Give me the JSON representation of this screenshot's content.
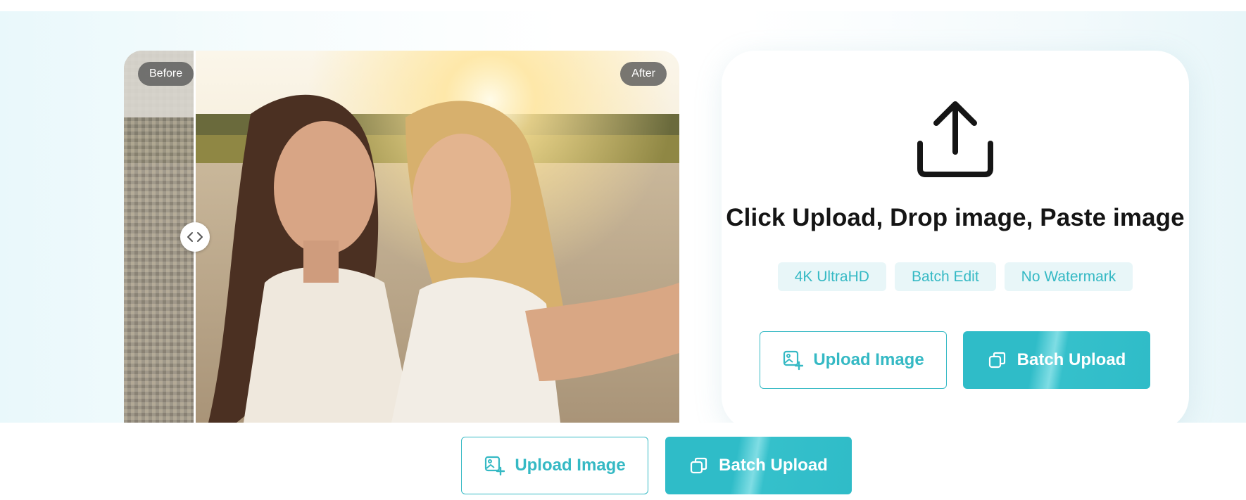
{
  "compare": {
    "before_label": "Before",
    "after_label": "After",
    "handle_icon": "chevrons-left-right-icon"
  },
  "upload_card": {
    "icon": "upload-arrow-icon",
    "title": "Click Upload, Drop image, Paste image",
    "features": [
      "4K UltraHD",
      "Batch Edit",
      "No Watermark"
    ],
    "upload_button": {
      "label": "Upload Image",
      "icon": "image-add-icon"
    },
    "batch_button": {
      "label": "Batch Upload",
      "icon": "copy-stack-icon"
    }
  },
  "bottom_bar": {
    "upload_button": {
      "label": "Upload Image",
      "icon": "image-add-icon"
    },
    "batch_button": {
      "label": "Batch Upload",
      "icon": "copy-stack-icon"
    }
  },
  "colors": {
    "accent": "#35b9c4",
    "feature_bg": "#e8f6f8",
    "title_text": "#151515"
  }
}
